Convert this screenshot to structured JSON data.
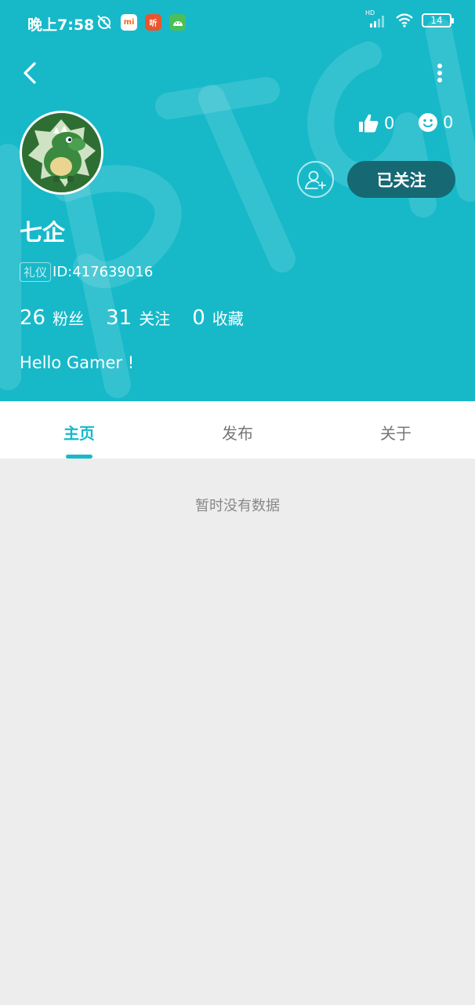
{
  "status_bar": {
    "time": "晚上7:58",
    "battery": "14",
    "network_label": "HD",
    "app_icons": [
      "mi-app-icon",
      "ting-app-icon",
      "android-app-icon"
    ],
    "app_icon_texts": [
      "mi",
      "听"
    ]
  },
  "profile": {
    "nickname": "七企",
    "tag": "礼仪",
    "id_text": "ID:417639016",
    "likes": "0",
    "smiles": "0",
    "follow_button": "已关注",
    "bio": "Hello Gamer !",
    "stats": [
      {
        "num": "26",
        "label": "粉丝"
      },
      {
        "num": "31",
        "label": "关注"
      },
      {
        "num": "0",
        "label": "收藏"
      }
    ]
  },
  "tabs": [
    {
      "label": "主页",
      "active": true
    },
    {
      "label": "发布",
      "active": false
    },
    {
      "label": "关于",
      "active": false
    }
  ],
  "empty_text": "暂时没有数据",
  "colors": {
    "accent": "#17b9c9",
    "follow_button_bg": "#166873",
    "page_bg": "#ededed"
  }
}
